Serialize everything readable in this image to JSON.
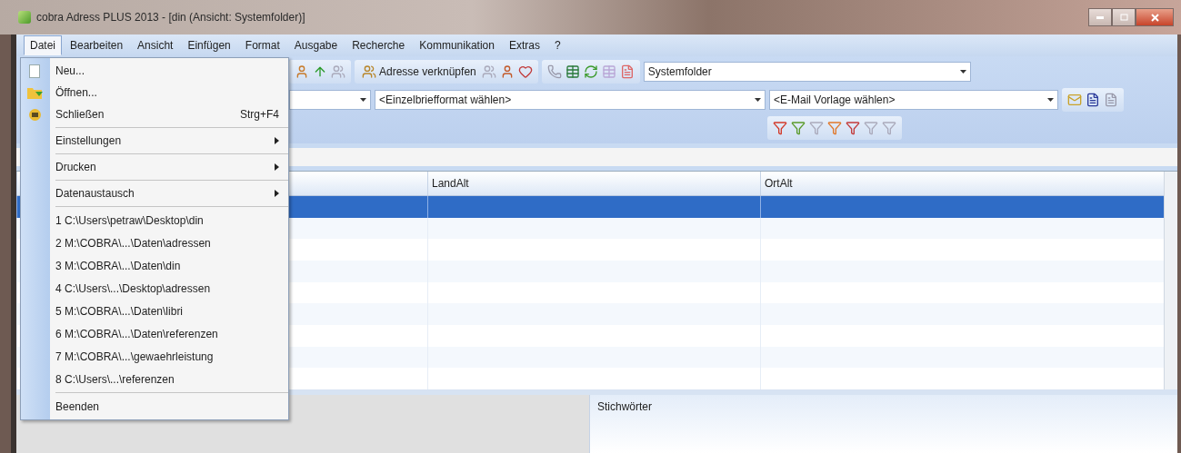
{
  "window": {
    "title": "cobra Adress PLUS 2013 - [din (Ansicht: Systemfolder)]"
  },
  "menubar": [
    {
      "label": "Datei",
      "selected": true
    },
    {
      "label": "Bearbeiten",
      "selected": false
    },
    {
      "label": "Ansicht",
      "selected": false
    },
    {
      "label": "Einfügen",
      "selected": false
    },
    {
      "label": "Format",
      "selected": false
    },
    {
      "label": "Ausgabe",
      "selected": false
    },
    {
      "label": "Recherche",
      "selected": false
    },
    {
      "label": "Kommunikation",
      "selected": false
    },
    {
      "label": "Extras",
      "selected": false
    },
    {
      "label": "?",
      "selected": false
    }
  ],
  "toolbar": {
    "link_button": "Adresse verknüpfen",
    "folder_select": "Systemfolder",
    "letter_format_select": "<Einzelbriefformat wählen>",
    "email_template_select": "<E-Mail Vorlage wählen>"
  },
  "file_menu": [
    {
      "kind": "page",
      "label": "Neu..."
    },
    {
      "kind": "folder",
      "label": "Öffnen..."
    },
    {
      "kind": "closer",
      "label": "Schließen",
      "shortcut": "Strg+F4"
    },
    {
      "kind": "separator"
    },
    {
      "kind": "submenu",
      "label": "Einstellungen"
    },
    {
      "kind": "separator"
    },
    {
      "kind": "submenu",
      "label": "Drucken"
    },
    {
      "kind": "separator"
    },
    {
      "kind": "submenu",
      "label": "Datenaustausch"
    },
    {
      "kind": "separator"
    },
    {
      "kind": "plain",
      "label": "1 C:\\Users\\petraw\\Desktop\\din"
    },
    {
      "kind": "plain",
      "label": "2 M:\\COBRA\\...\\Daten\\adressen"
    },
    {
      "kind": "plain",
      "label": "3 M:\\COBRA\\...\\Daten\\din"
    },
    {
      "kind": "plain",
      "label": "4 C:\\Users\\...\\Desktop\\adressen"
    },
    {
      "kind": "plain",
      "label": "5 M:\\COBRA\\...\\Daten\\libri"
    },
    {
      "kind": "plain",
      "label": "6 M:\\COBRA\\...\\Daten\\referenzen"
    },
    {
      "kind": "plain",
      "label": "7 M:\\COBRA\\...\\gewaehrleistung"
    },
    {
      "kind": "plain",
      "label": "8 C:\\Users\\...\\referenzen"
    },
    {
      "kind": "separator"
    },
    {
      "kind": "plain",
      "label": "Beenden"
    }
  ],
  "table": {
    "columns": [
      {
        "label": "LandAlt"
      },
      {
        "label": "OrtAlt"
      }
    ],
    "rows": [
      {
        "selected": true
      },
      {
        "selected": false
      },
      {
        "selected": false
      },
      {
        "selected": false
      },
      {
        "selected": false
      },
      {
        "selected": false
      },
      {
        "selected": false
      },
      {
        "selected": false
      },
      {
        "selected": false
      }
    ]
  },
  "bottom_panel": {
    "title": "Stichwörter"
  }
}
